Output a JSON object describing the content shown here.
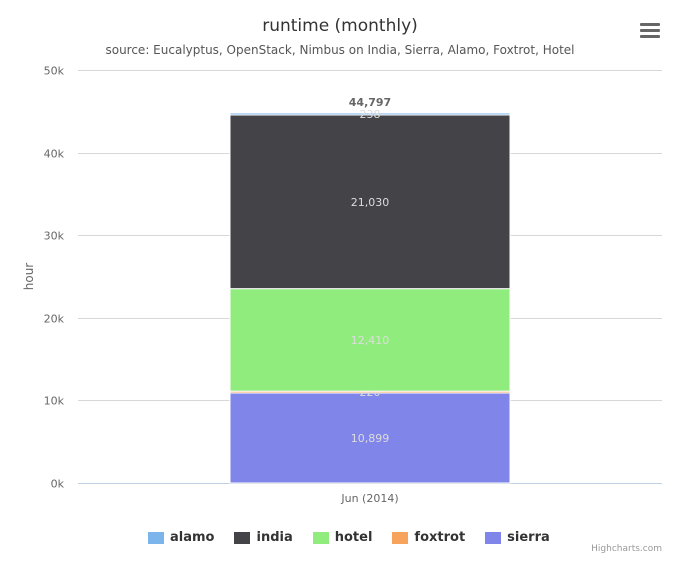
{
  "chart_data": {
    "type": "bar",
    "stacked": true,
    "title": "runtime (monthly)",
    "subtitle": "source: Eucalyptus, OpenStack, Nimbus on India, Sierra, Alamo, Foxtrot, Hotel",
    "xlabel": "",
    "ylabel": "hour",
    "ylim": [
      0,
      50000
    ],
    "yticks": [
      0,
      10000,
      20000,
      30000,
      40000,
      50000
    ],
    "ytick_labels": [
      "0k",
      "10k",
      "20k",
      "30k",
      "40k",
      "50k"
    ],
    "categories": [
      "Jun (2014)"
    ],
    "grid": true,
    "legend": "bottom",
    "stack_total_label": "44,797",
    "series": [
      {
        "name": "alamo",
        "color": "#7cb5ec",
        "values": [
          238
        ],
        "label": "238"
      },
      {
        "name": "india",
        "color": "#434348",
        "values": [
          21030
        ],
        "label": "21,030"
      },
      {
        "name": "hotel",
        "color": "#90ed7d",
        "values": [
          12410
        ],
        "label": "12,410"
      },
      {
        "name": "foxtrot",
        "color": "#f7a35c",
        "values": [
          220
        ],
        "label": "220"
      },
      {
        "name": "sierra",
        "color": "#8085e9",
        "values": [
          10899
        ],
        "label": "10,899"
      }
    ]
  },
  "credits": "Highcharts.com",
  "menu_icon": "hamburger-menu-icon"
}
